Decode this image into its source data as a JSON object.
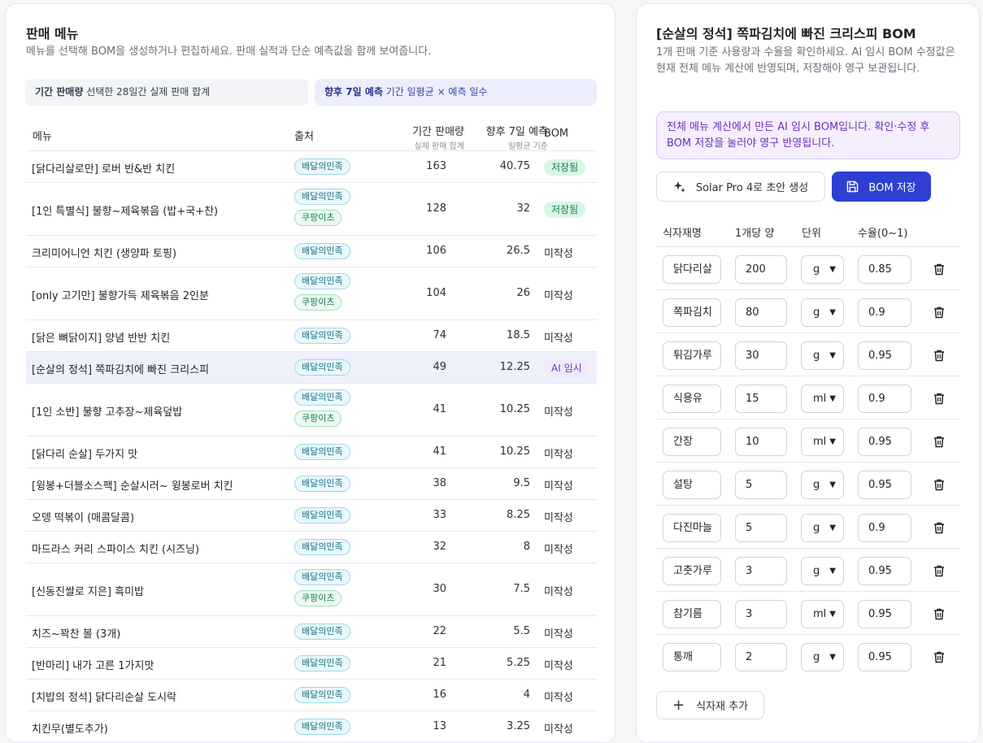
{
  "left": {
    "title": "판매 메뉴",
    "subtitle": "메뉴를 선택해 BOM을 생성하거나 편집하세요. 판매 실적과 단순 예측값을 함께 보여줍니다.",
    "hint_period": {
      "bold": "기간 판매량",
      "text": "선택한 28일간 실제 판매 합계"
    },
    "hint_forecast": {
      "bold": "향후 7일 예측",
      "text": "기간 일평균 × 예측 일수"
    },
    "columns": {
      "menu": "메뉴",
      "source": "출처",
      "period_sales": "기간 판매량",
      "period_sales_sub": "실제 판매 합계",
      "forecast": "향후 7일 예측",
      "forecast_sub": "일평균 기준",
      "bom": "BOM"
    },
    "rows": [
      {
        "name": "[닭다리살로만] 로버 반&반 치킨",
        "sources": [
          "배달의민족"
        ],
        "sales": "163",
        "forecast": "40.75",
        "bom": "저장됨"
      },
      {
        "name": "[1인 특별식] 불향~제육볶음 (밥+국+찬)",
        "sources": [
          "배달의민족",
          "쿠팡이츠"
        ],
        "sales": "128",
        "forecast": "32",
        "bom": "저장됨"
      },
      {
        "name": "크리미어니언 치킨 (생양파 토핑)",
        "sources": [
          "배달의민족"
        ],
        "sales": "106",
        "forecast": "26.5",
        "bom": "미작성"
      },
      {
        "name": "[only 고기만] 불향가득 제육볶음 2인분",
        "sources": [
          "배달의민족",
          "쿠팡이츠"
        ],
        "sales": "104",
        "forecast": "26",
        "bom": "미작성"
      },
      {
        "name": "[닭은 뼈닭이지] 양념 반반 치킨",
        "sources": [
          "배달의민족"
        ],
        "sales": "74",
        "forecast": "18.5",
        "bom": "미작성"
      },
      {
        "name": "[순살의 정석] 쪽파김치에 빠진 크리스피",
        "sources": [
          "배달의민족"
        ],
        "sales": "49",
        "forecast": "12.25",
        "bom": "AI 임시"
      },
      {
        "name": "[1인 소반] 불향 고추장~제육덮밥",
        "sources": [
          "배달의민족",
          "쿠팡이츠"
        ],
        "sales": "41",
        "forecast": "10.25",
        "bom": "미작성"
      },
      {
        "name": "[닭다리 순살] 두가지 맛",
        "sources": [
          "배달의민족"
        ],
        "sales": "41",
        "forecast": "10.25",
        "bom": "미작성"
      },
      {
        "name": "[윙봉+더블소스팩] 순살시러~ 윙봉로버 치킨",
        "sources": [
          "배달의민족"
        ],
        "sales": "38",
        "forecast": "9.5",
        "bom": "미작성"
      },
      {
        "name": "오뎅 떡볶이 (매콤달콤)",
        "sources": [
          "배달의민족"
        ],
        "sales": "33",
        "forecast": "8.25",
        "bom": "미작성"
      },
      {
        "name": "마드라스 커리 스파이스 치킨 (시즈닝)",
        "sources": [
          "배달의민족"
        ],
        "sales": "32",
        "forecast": "8",
        "bom": "미작성"
      },
      {
        "name": "[신동진쌀로 지은] 흑미밥",
        "sources": [
          "배달의민족",
          "쿠팡이츠"
        ],
        "sales": "30",
        "forecast": "7.5",
        "bom": "미작성"
      },
      {
        "name": "치즈~꽉찬 볼 (3개)",
        "sources": [
          "배달의민족"
        ],
        "sales": "22",
        "forecast": "5.5",
        "bom": "미작성"
      },
      {
        "name": "[반마리] 내가 고른 1가지맛",
        "sources": [
          "배달의민족"
        ],
        "sales": "21",
        "forecast": "5.25",
        "bom": "미작성"
      },
      {
        "name": "[치밥의 정석] 닭다리순살 도시락",
        "sources": [
          "배달의민족"
        ],
        "sales": "16",
        "forecast": "4",
        "bom": "미작성"
      },
      {
        "name": "치킨무(별도추가)",
        "sources": [
          "배달의민족"
        ],
        "sales": "13",
        "forecast": "3.25",
        "bom": "미작성"
      }
    ]
  },
  "right": {
    "title": "[순살의 정석] 쪽파김치에 빠진 크리스피 BOM",
    "subtitle": "1개 판매 기준 사용량과 수율을 확인하세요. AI 임시 BOM 수정값은 현재 전체 메뉴 계산에 반영되며, 저장해야 영구 보관됩니다.",
    "notice": "전체 메뉴 계산에서 만든 AI 임시 BOM입니다. 확인·수정 후 BOM 저장을 눌러야 영구 반영됩니다.",
    "solar_button": "Solar Pro 4로 초안 생성",
    "save_button": "BOM 저장",
    "columns": {
      "name": "식자재명",
      "qty": "1개당 양",
      "unit": "단위",
      "yield": "수율(0~1)"
    },
    "items": [
      {
        "name": "닭다리살",
        "qty": "200",
        "unit": "g",
        "yield": "0.85"
      },
      {
        "name": "쪽파김치",
        "qty": "80",
        "unit": "g",
        "yield": "0.9"
      },
      {
        "name": "튀김가루",
        "qty": "30",
        "unit": "g",
        "yield": "0.95"
      },
      {
        "name": "식용유",
        "qty": "15",
        "unit": "ml",
        "yield": "0.9"
      },
      {
        "name": "간장",
        "qty": "10",
        "unit": "ml",
        "yield": "0.95"
      },
      {
        "name": "설탕",
        "qty": "5",
        "unit": "g",
        "yield": "0.95"
      },
      {
        "name": "다진마늘",
        "qty": "5",
        "unit": "g",
        "yield": "0.9"
      },
      {
        "name": "고춧가루",
        "qty": "3",
        "unit": "g",
        "yield": "0.95"
      },
      {
        "name": "참기름",
        "qty": "3",
        "unit": "ml",
        "yield": "0.95"
      },
      {
        "name": "통깨",
        "qty": "2",
        "unit": "g",
        "yield": "0.95"
      }
    ],
    "add_button": "식자재 추가"
  }
}
